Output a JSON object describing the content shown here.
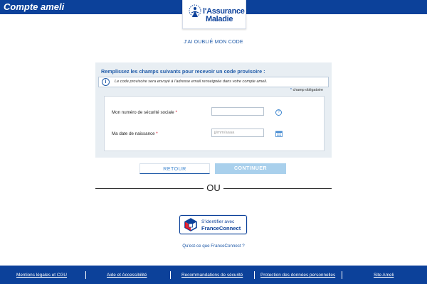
{
  "header": {
    "app_title": "Compte ameli",
    "logo_line1": "l'Assurance",
    "logo_line2": "Maladie"
  },
  "page": {
    "heading": "J'AI OUBLIÉ MON CODE"
  },
  "form": {
    "title": "Remplissez les champs suivants pour recevoir un code provisoire :",
    "info_text": "Le code provisoire sera envoyé à l'adresse email renseignée dans votre compte ameli.",
    "required_note": "champ obligatoire",
    "required_star": "*",
    "fields": [
      {
        "label": "Mon numéro de sécurité sociale",
        "value": "",
        "placeholder": ""
      },
      {
        "label": "Ma date de naissance",
        "value": "",
        "placeholder": "jj/mm/aaaa"
      }
    ],
    "help_glyph": "?"
  },
  "actions": {
    "back_label": "RETOUR",
    "continue_label": "CONTINUER"
  },
  "divider": {
    "text": "OU"
  },
  "france_connect": {
    "line1": "S'identifier avec",
    "line2": "FranceConnect",
    "link": "Qu'est-ce que FranceConnect ?"
  },
  "footer": {
    "links": [
      "Mentions légales et CGU",
      "Aide et Accessibilité",
      "Recommandations de sécurité",
      "Protection des données personnelles",
      "Site Ameli"
    ]
  },
  "colors": {
    "brand_blue": "#0c419a",
    "link_blue": "#1f5aa8",
    "panel_bg": "#e8eef3",
    "continue_bg": "#a9d0ec"
  },
  "icons": {
    "info": "info-icon",
    "help": "help-icon",
    "calendar": "calendar-icon",
    "logo": "assurance-maladie-logo-icon",
    "france_connect": "france-connect-logo-icon"
  }
}
